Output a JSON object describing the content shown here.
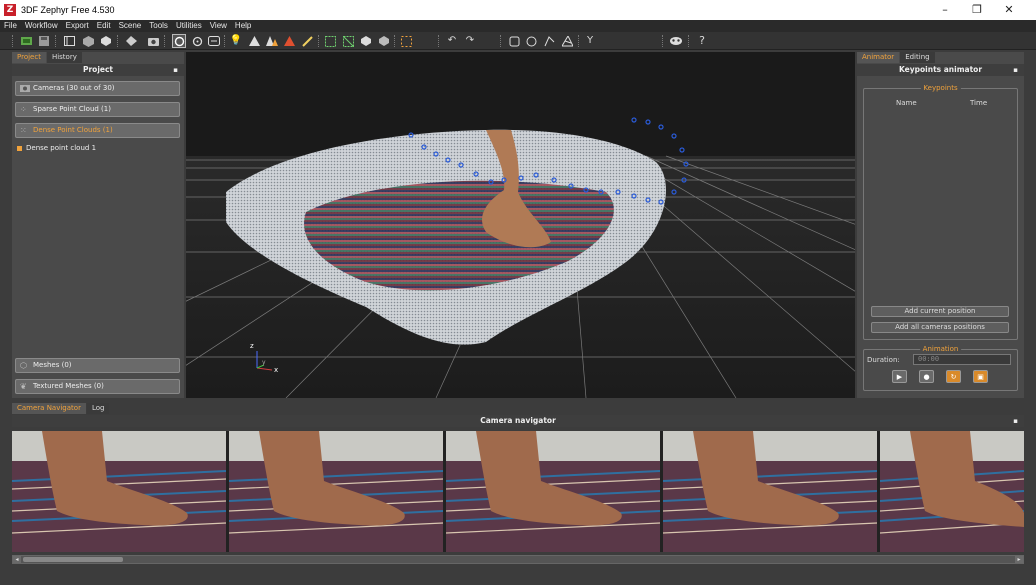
{
  "window": {
    "title": "3DF Zephyr Free 4.530",
    "app_icon": "Z",
    "controls": {
      "minimize": "–",
      "maximize": "❐",
      "close": "✕"
    }
  },
  "menu": [
    "File",
    "Workflow",
    "Export",
    "Edit",
    "Scene",
    "Tools",
    "Utilities",
    "View",
    "Help"
  ],
  "toolbar": {
    "icons": [
      "new-project-icon",
      "save-icon",
      "open-icon",
      "workspace-icon",
      "object-icon",
      "sparse-icon",
      "camera-icon",
      "orbit-icon",
      "rotate-icon",
      "measure-icon",
      "light-icon",
      "points-icon",
      "point-cloud-icon",
      "brush-icon",
      "select-icon",
      "crop-icon",
      "box-icon",
      "sphere-icon",
      "frame-icon",
      "undo-icon",
      "redo-icon",
      "lasso-icon",
      "circle-select-icon",
      "pointer-icon",
      "plane-icon",
      "branch-icon",
      "mask-icon",
      "help-icon"
    ],
    "help_label": "?"
  },
  "left_panel": {
    "tabs": [
      "Project",
      "History"
    ],
    "title": "Project",
    "pin": "▪",
    "groups": {
      "cameras": "Cameras (30 out of 30)",
      "sparse": "Sparse Point Cloud (1)",
      "dense": "Dense Point Clouds (1)",
      "meshes": "Meshes (0)",
      "textured": "Textured Meshes (0)"
    },
    "tree_item": "Dense point cloud 1"
  },
  "viewport": {
    "axes": {
      "z": "z",
      "y": "y",
      "x": "x"
    }
  },
  "right_panel": {
    "tabs": [
      "Animator",
      "Editing"
    ],
    "title": "Keypoints animator",
    "pin": "▪",
    "keypoints_legend": "Keypoints",
    "col_name": "Name",
    "col_time": "Time",
    "btn_add_current": "Add current position",
    "btn_add_all": "Add all cameras positions",
    "animation_legend": "Animation",
    "duration_label": "Duration:",
    "duration_value": "00:00"
  },
  "bottom": {
    "tabs": [
      "Camera Navigator",
      "Log"
    ],
    "title": "Camera navigator",
    "pin": "▪"
  },
  "colors": {
    "accent": "#f0a23c",
    "panel": "#4a4a4a",
    "viewport_bg": "#1a1a1a",
    "camera_marker": "#2a5bd7"
  }
}
